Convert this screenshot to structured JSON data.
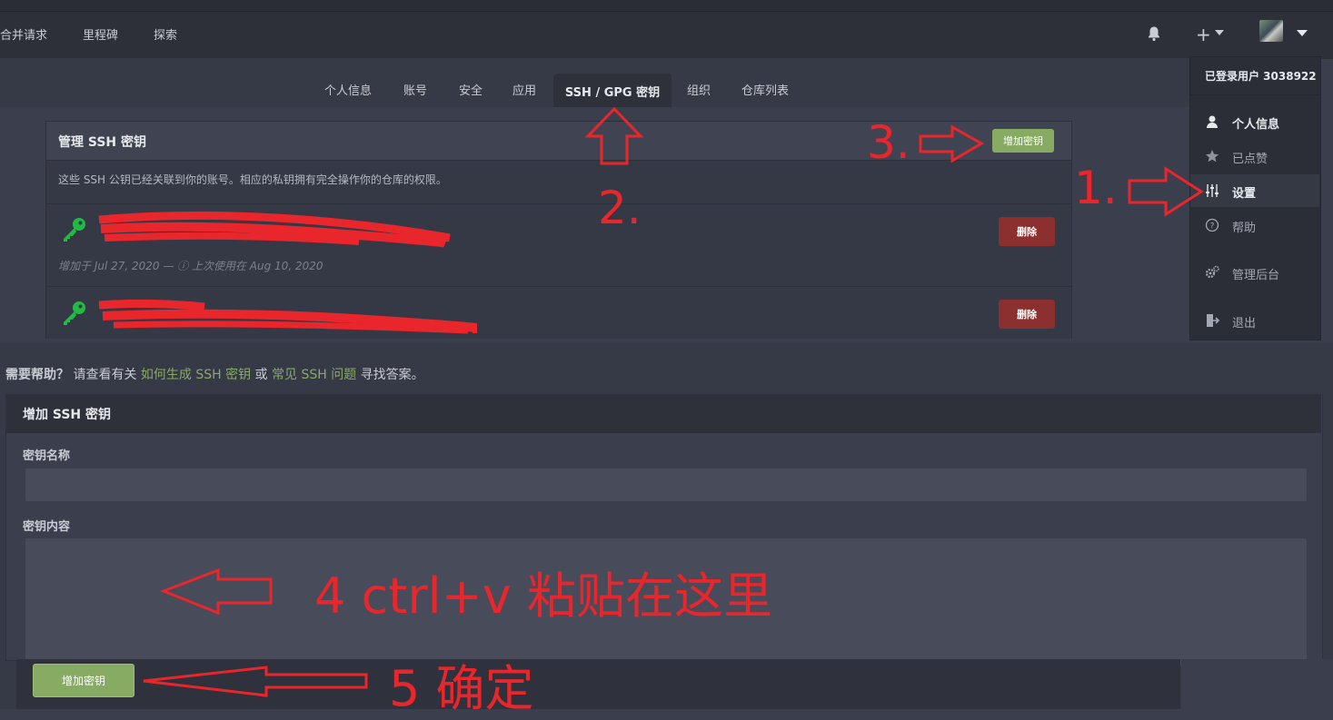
{
  "nav": {
    "links": [
      "合并请求",
      "里程碑",
      "探索"
    ],
    "plus_label": "+"
  },
  "tabs": [
    "个人信息",
    "账号",
    "安全",
    "应用",
    "SSH / GPG 密钥",
    "组织",
    "仓库列表"
  ],
  "manage_ssh": {
    "title": "管理 SSH 密钥",
    "add_button": "增加密钥",
    "description": "这些 SSH 公钥已经关联到你的账号。相应的私钥拥有完全操作你的仓库的权限。",
    "keys": [
      {
        "meta": "增加于 Jul 27, 2020 — ⓘ 上次使用在 Aug 10, 2020",
        "delete_label": "删除"
      },
      {
        "delete_label": "删除"
      }
    ]
  },
  "dropdown": {
    "header": "已登录用户 3038922",
    "items": [
      "个人信息",
      "已点赞",
      "设置",
      "帮助",
      "管理后台",
      "退出"
    ]
  },
  "help": {
    "prefix": "需要帮助？",
    "text1": " 请查看有关 ",
    "link1": "如何生成 SSH 密钥",
    "text2": " 或 ",
    "link2": "常见 SSH 问题",
    "text3": " 寻找答案。"
  },
  "add_ssh": {
    "title": "增加 SSH 密钥",
    "name_label": "密钥名称",
    "name_value": "",
    "content_label": "密钥内容",
    "content_value": "",
    "submit_label": "增加密钥"
  },
  "annotations": {
    "step1": "1.",
    "step2": "2.",
    "step3": "3.",
    "step4": "4 ctrl+v 粘贴在这里",
    "step5": "5 确定"
  },
  "colors": {
    "accent_green": "#87ab63",
    "danger_red": "#8c2f2f",
    "annotation_red": "#e8262b",
    "key_green": "#21ba45"
  }
}
